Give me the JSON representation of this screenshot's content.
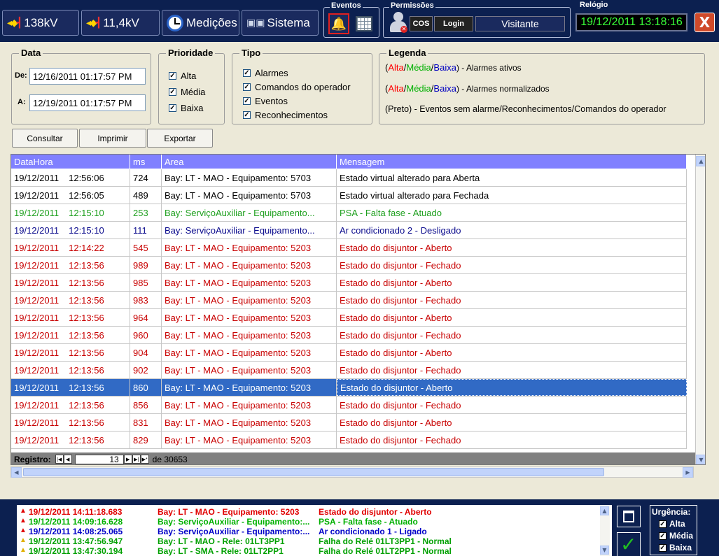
{
  "toolbar": {
    "btn_138": "138kV",
    "btn_11": "11,4kV",
    "btn_medicoes": "Medições",
    "btn_sistema": "Sistema",
    "eventos_title": "Eventos",
    "permissoes_title": "Permissões",
    "cos": "COS",
    "login": "Login",
    "user": "Visitante",
    "relogio_title": "Relógio",
    "clock": "19/12/2011 13:18:16",
    "close": "X"
  },
  "filters": {
    "data_title": "Data",
    "de_label": "De:",
    "de_value": "12/16/2011 01:17:57 PM",
    "a_label": "A:",
    "a_value": "12/19/2011 01:17:57 PM",
    "prioridade_title": "Prioridade",
    "prioridades": [
      {
        "label": "Alta",
        "checked": true
      },
      {
        "label": "Média",
        "checked": true
      },
      {
        "label": "Baixa",
        "checked": true
      }
    ],
    "tipo_title": "Tipo",
    "tipos": [
      {
        "label": "Alarmes",
        "checked": true
      },
      {
        "label": "Comandos do operador",
        "checked": true
      },
      {
        "label": "Eventos",
        "checked": true
      },
      {
        "label": "Reconhecimentos",
        "checked": true
      }
    ],
    "legenda_title": "Legenda",
    "legend1_alta": "Alta",
    "legend1_media": "Média",
    "legend1_baixa": "Baixa",
    "legend1_text": ") - Alarmes ativos",
    "legend2_text": ") - Alarmes normalizados",
    "legend3": "(Preto) - Eventos sem alarme/Reconhecimentos/Comandos do operador",
    "colors": {
      "alta": "#ff0000",
      "media": "#00b000",
      "baixa": "#0000c0"
    }
  },
  "actions": {
    "consultar": "Consultar",
    "imprimir": "Imprimir",
    "exportar": "Exportar"
  },
  "grid": {
    "headers": [
      "DataHora",
      "ms",
      "Area",
      "Mensagem"
    ],
    "rows": [
      {
        "date": "19/12/2011",
        "time": "12:56:06",
        "ms": "724",
        "area": "Bay: LT - MAO - Equipamento: 5703",
        "msg": "Estado virtual alterado para Aberta",
        "color": "#000000"
      },
      {
        "date": "19/12/2011",
        "time": "12:56:05",
        "ms": "489",
        "area": "Bay: LT - MAO - Equipamento: 5703",
        "msg": "Estado virtual alterado para Fechada",
        "color": "#000000"
      },
      {
        "date": "19/12/2011",
        "time": "12:15:10",
        "ms": "253",
        "area": "Bay: ServiçoAuxiliar - Equipamento...",
        "msg": "PSA - Falta fase - Atuado",
        "color": "#1fa01f"
      },
      {
        "date": "19/12/2011",
        "time": "12:15:10",
        "ms": "111",
        "area": "Bay: ServiçoAuxiliar - Equipamento...",
        "msg": "Ar condicionado 2 - Desligado",
        "color": "#0a0a8c"
      },
      {
        "date": "19/12/2011",
        "time": "12:14:22",
        "ms": "545",
        "area": "Bay: LT - MAO - Equipamento: 5203",
        "msg": "Estado do disjuntor - Aberto",
        "color": "#c80000"
      },
      {
        "date": "19/12/2011",
        "time": "12:13:56",
        "ms": "989",
        "area": "Bay: LT - MAO - Equipamento: 5203",
        "msg": "Estado do disjuntor - Fechado",
        "color": "#c80000"
      },
      {
        "date": "19/12/2011",
        "time": "12:13:56",
        "ms": "985",
        "area": "Bay: LT - MAO - Equipamento: 5203",
        "msg": "Estado do disjuntor - Aberto",
        "color": "#c80000"
      },
      {
        "date": "19/12/2011",
        "time": "12:13:56",
        "ms": "983",
        "area": "Bay: LT - MAO - Equipamento: 5203",
        "msg": "Estado do disjuntor - Fechado",
        "color": "#c80000"
      },
      {
        "date": "19/12/2011",
        "time": "12:13:56",
        "ms": "964",
        "area": "Bay: LT - MAO - Equipamento: 5203",
        "msg": "Estado do disjuntor - Aberto",
        "color": "#c80000"
      },
      {
        "date": "19/12/2011",
        "time": "12:13:56",
        "ms": "960",
        "area": "Bay: LT - MAO - Equipamento: 5203",
        "msg": "Estado do disjuntor - Fechado",
        "color": "#c80000"
      },
      {
        "date": "19/12/2011",
        "time": "12:13:56",
        "ms": "904",
        "area": "Bay: LT - MAO - Equipamento: 5203",
        "msg": "Estado do disjuntor - Aberto",
        "color": "#c80000"
      },
      {
        "date": "19/12/2011",
        "time": "12:13:56",
        "ms": "902",
        "area": "Bay: LT - MAO - Equipamento: 5203",
        "msg": "Estado do disjuntor - Fechado",
        "color": "#c80000"
      },
      {
        "date": "19/12/2011",
        "time": "12:13:56",
        "ms": "860",
        "area": "Bay: LT - MAO - Equipamento: 5203",
        "msg": "Estado do disjuntor - Aberto",
        "color": "#c80000",
        "selected": true
      },
      {
        "date": "19/12/2011",
        "time": "12:13:56",
        "ms": "856",
        "area": "Bay: LT - MAO - Equipamento: 5203",
        "msg": "Estado do disjuntor - Fechado",
        "color": "#c80000"
      },
      {
        "date": "19/12/2011",
        "time": "12:13:56",
        "ms": "831",
        "area": "Bay: LT - MAO - Equipamento: 5203",
        "msg": "Estado do disjuntor - Aberto",
        "color": "#c80000"
      },
      {
        "date": "19/12/2011",
        "time": "12:13:56",
        "ms": "829",
        "area": "Bay: LT - MAO - Equipamento: 5203",
        "msg": "Estado do disjuntor - Fechado",
        "color": "#c80000"
      }
    ],
    "registro_label": "Registro:",
    "registro_value": "13",
    "registro_total": "de 30653"
  },
  "alarms": [
    {
      "time": "19/12/2011 14:11:18.683",
      "area": "Bay: LT - MAO - Equipamento: 5203",
      "msg": "Estado do disjuntor - Aberto",
      "color": "#e00000",
      "bell": "#e00000"
    },
    {
      "time": "19/12/2011 14:09:16.628",
      "area": "Bay: ServiçoAuxiliar - Equipamento:...",
      "msg": "PSA - Falta fase - Atuado",
      "color": "#00b000",
      "bell": "#e00000"
    },
    {
      "time": "19/12/2011 14:08:25.065",
      "area": "Bay: ServiçoAuxiliar - Equipamento:...",
      "msg": "Ar condicionado 1 - Ligado",
      "color": "#0000c8",
      "bell": "#e00000"
    },
    {
      "time": "19/12/2011 13:47:56.947",
      "area": "Bay: LT - MAO - Rele: 01LT3PP1",
      "msg": "Falha do Relé 01LT3PP1 - Normal",
      "color": "#00a000",
      "bell": "#e0b000"
    },
    {
      "time": "19/12/2011 13:47:30.194",
      "area": "Bay: LT - SMA - Rele: 01LT2PP1",
      "msg": "Falha do Relé 01LT2PP1 - Normal",
      "color": "#00a000",
      "bell": "#e0b000"
    }
  ],
  "urgency": {
    "title": "Urgência:",
    "items": [
      {
        "label": "Alta",
        "checked": true
      },
      {
        "label": "Média",
        "checked": true
      },
      {
        "label": "Baixa",
        "checked": true
      }
    ]
  }
}
